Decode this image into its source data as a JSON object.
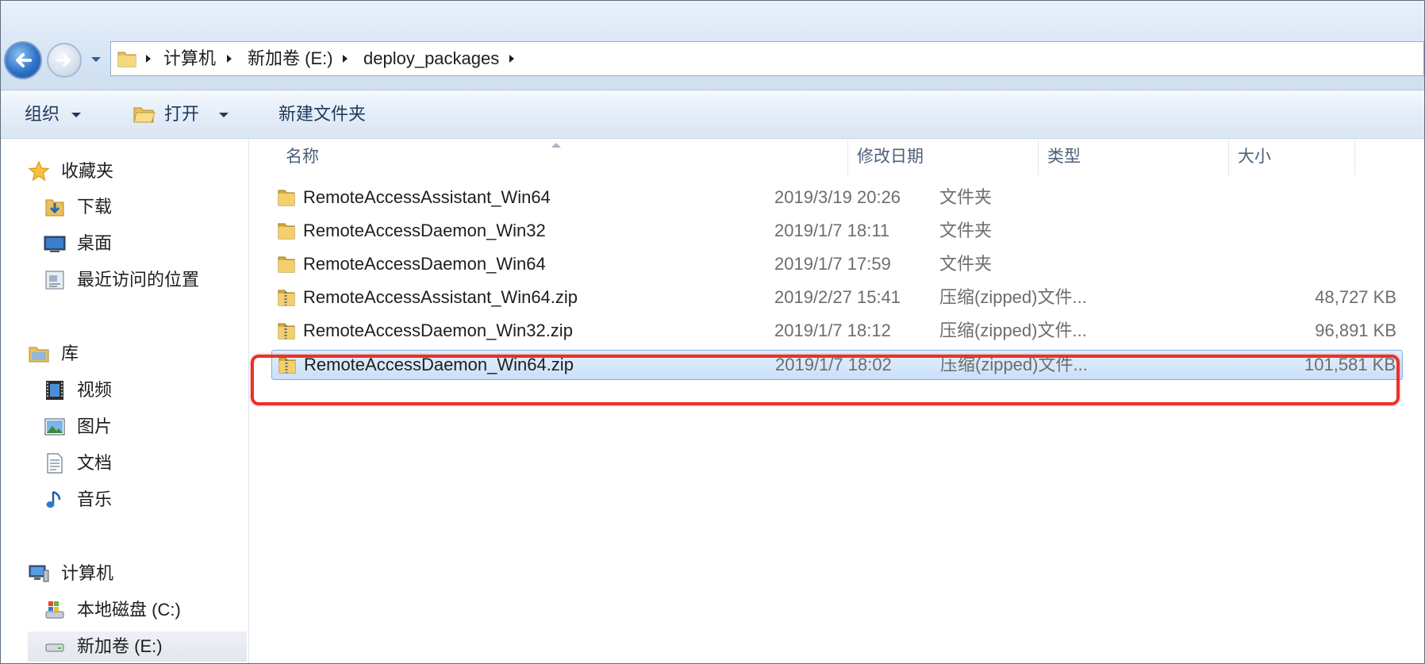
{
  "address_bar": {
    "breadcrumbs": [
      "计算机",
      "新加卷 (E:)",
      "deploy_packages"
    ]
  },
  "command_bar": {
    "organize": "组织",
    "open": "打开",
    "new_folder": "新建文件夹"
  },
  "nav_pane": {
    "favorites": {
      "label": "收藏夹",
      "items": [
        "下载",
        "桌面",
        "最近访问的位置"
      ]
    },
    "libraries": {
      "label": "库",
      "items": [
        "视频",
        "图片",
        "文档",
        "音乐"
      ]
    },
    "computer": {
      "label": "计算机",
      "items": [
        "本地磁盘 (C:)",
        "新加卷 (E:)"
      ]
    }
  },
  "file_list": {
    "columns": [
      "名称",
      "修改日期",
      "类型",
      "大小"
    ],
    "rows": [
      {
        "name": "RemoteAccessAssistant_Win64",
        "date": "2019/3/19 20:26",
        "type": "文件夹",
        "size": "",
        "icon": "folder-icon"
      },
      {
        "name": "RemoteAccessDaemon_Win32",
        "date": "2019/1/7 18:11",
        "type": "文件夹",
        "size": "",
        "icon": "folder-icon"
      },
      {
        "name": "RemoteAccessDaemon_Win64",
        "date": "2019/1/7 17:59",
        "type": "文件夹",
        "size": "",
        "icon": "folder-icon"
      },
      {
        "name": "RemoteAccessAssistant_Win64.zip",
        "date": "2019/2/27 15:41",
        "type": "压缩(zipped)文件...",
        "size": "48,727 KB",
        "icon": "zip-folder-icon"
      },
      {
        "name": "RemoteAccessDaemon_Win32.zip",
        "date": "2019/1/7 18:12",
        "type": "压缩(zipped)文件...",
        "size": "96,891 KB",
        "icon": "zip-folder-icon"
      },
      {
        "name": "RemoteAccessDaemon_Win64.zip",
        "date": "2019/1/7 18:02",
        "type": "压缩(zipped)文件...",
        "size": "101,581 KB",
        "icon": "zip-folder-icon",
        "selected": true
      }
    ]
  },
  "colors": {
    "highlight": "#e8332a",
    "selection": "#c9e0f9",
    "header_text": "#4c607a"
  }
}
